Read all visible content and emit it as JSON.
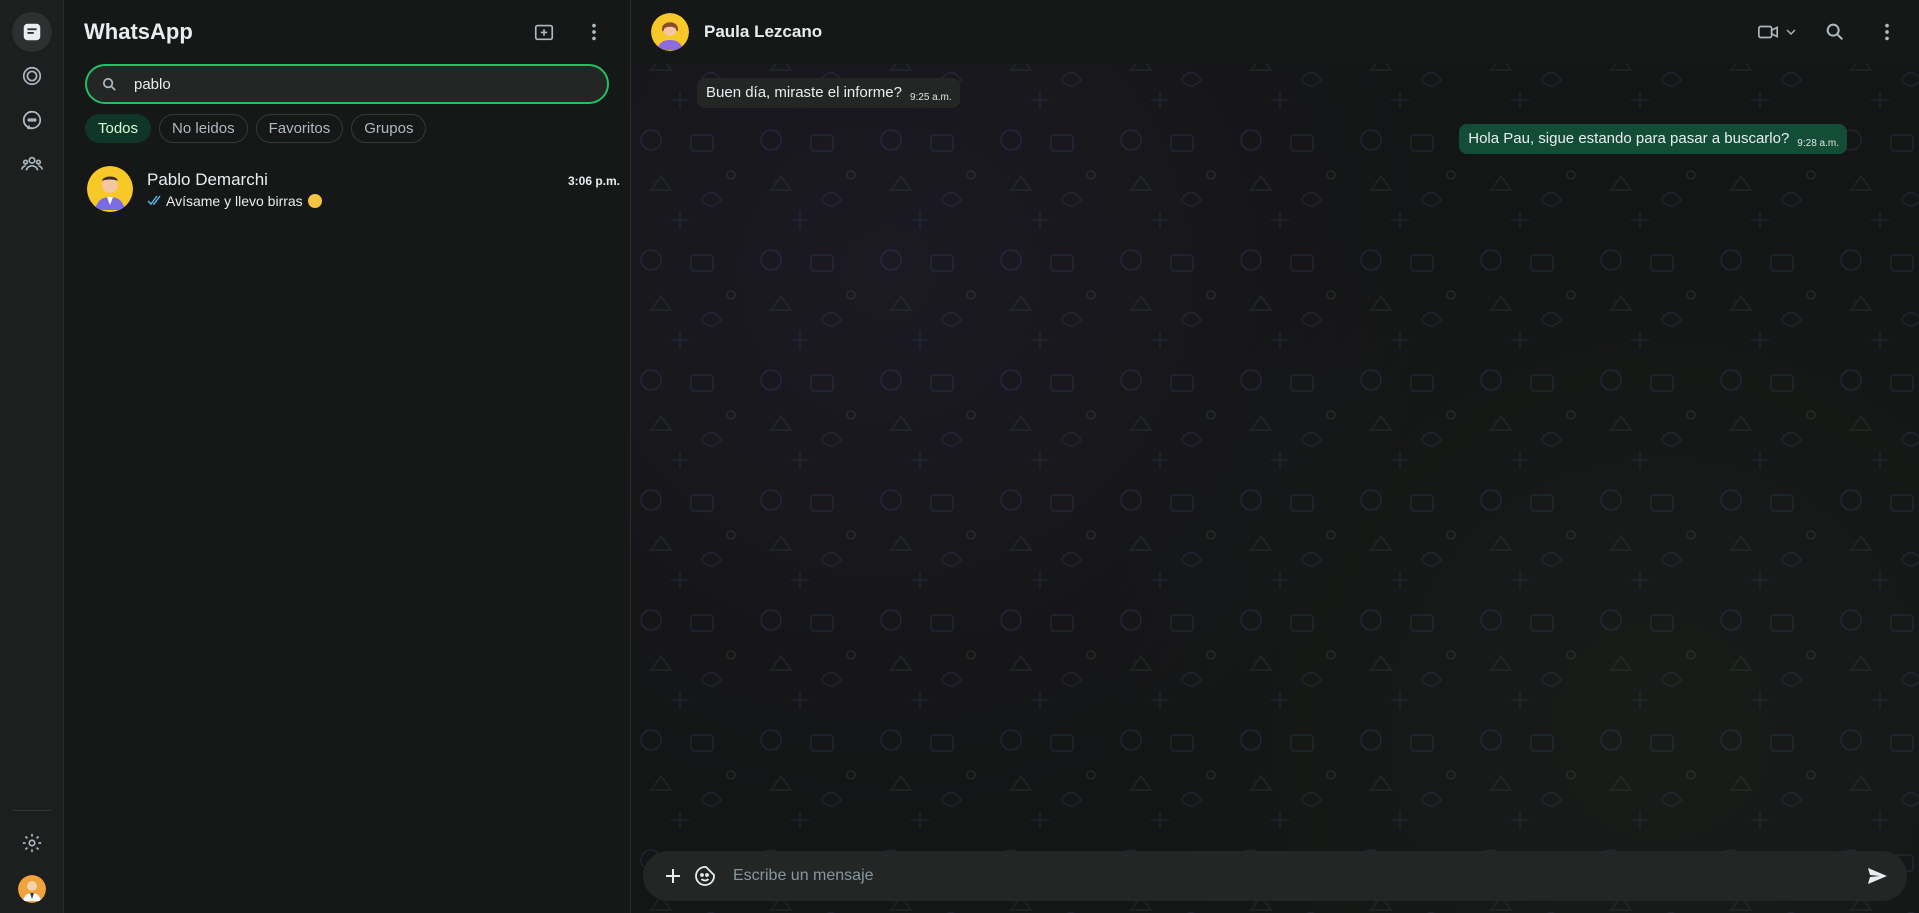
{
  "app": {
    "title": "WhatsApp"
  },
  "search": {
    "value": "pablo"
  },
  "filters": [
    "Todos",
    "No leidos",
    "Favoritos",
    "Grupos"
  ],
  "chat_list": [
    {
      "name": "Pablo Demarchi",
      "time": "3:06 p.m.",
      "last_message": "Avísame y llevo birras"
    }
  ],
  "conversation": {
    "contact_name": "Paula Lezcano",
    "messages": [
      {
        "direction": "in",
        "text": "Buen día, miraste el informe?",
        "time": "9:25 a.m."
      },
      {
        "direction": "out",
        "text": "Hola Pau, sigue estando para pasar a buscarlo?",
        "time": "9:28 a.m."
      }
    ]
  },
  "composer": {
    "placeholder": "Escribe un mensaje"
  },
  "colors": {
    "accent": "#21c063",
    "outgoing_bubble": "#144d37",
    "incoming_bubble": "#242626",
    "background": "#161717"
  }
}
